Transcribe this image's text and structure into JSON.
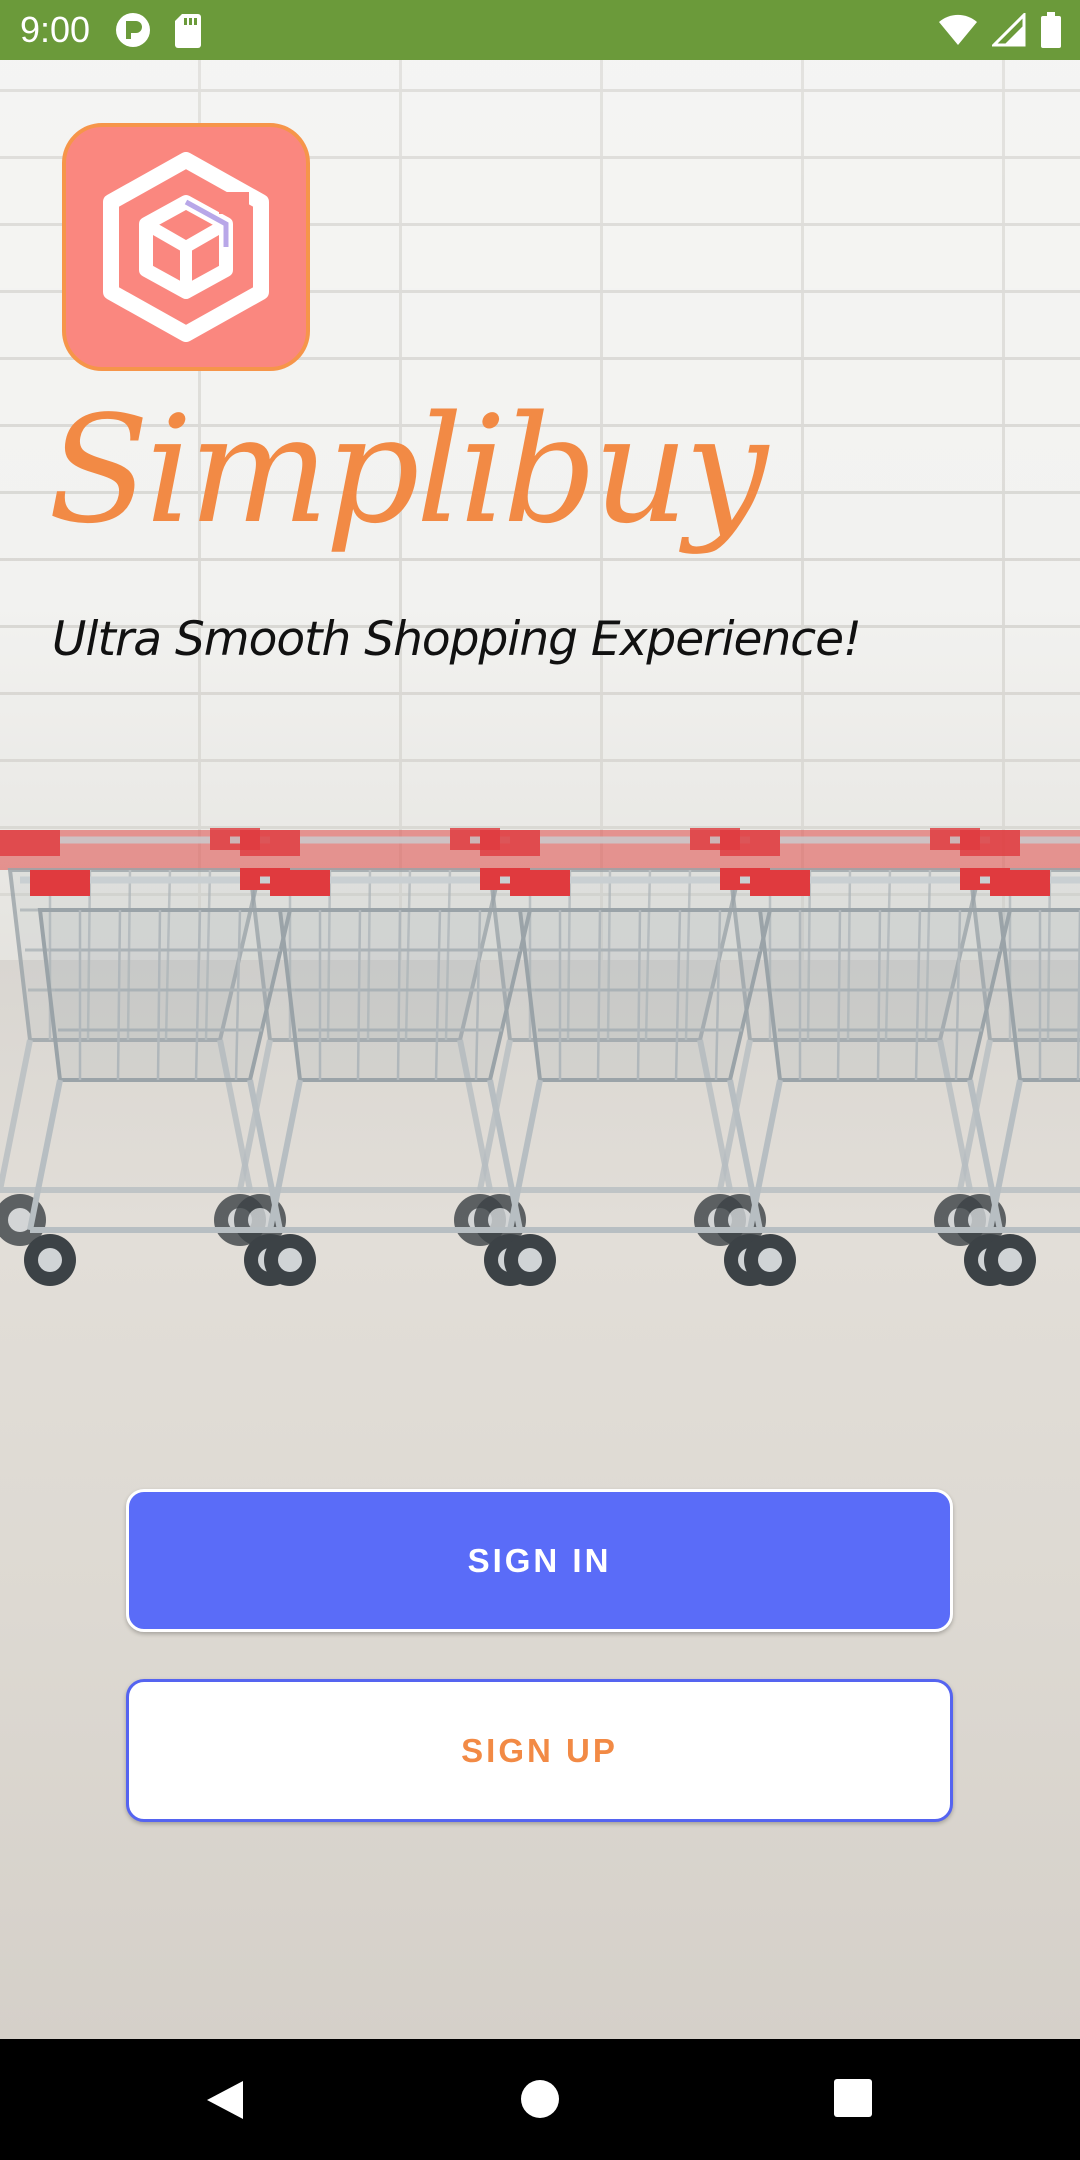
{
  "status_bar": {
    "time": "9:00",
    "left_icons": [
      "cloud-p-icon",
      "sd-card-icon"
    ],
    "right_icons": [
      "wifi-icon",
      "signal-icon",
      "battery-icon"
    ]
  },
  "app": {
    "logo_icon": "hexagon-box-logo-icon",
    "name": "Simplibuy",
    "tagline": "Ultra Smooth Shopping Experience!"
  },
  "actions": {
    "sign_in_label": "SIGN IN",
    "sign_up_label": "SIGN UP"
  },
  "nav_bar": {
    "buttons": [
      "back-icon",
      "home-icon",
      "recents-icon"
    ]
  },
  "colors": {
    "status_bar": "#6b9a3a",
    "logo_bg": "#fa877f",
    "brand_orange": "#f28a45",
    "sign_in_bg": "#5a6cf8",
    "sign_up_border": "#5564f0"
  }
}
